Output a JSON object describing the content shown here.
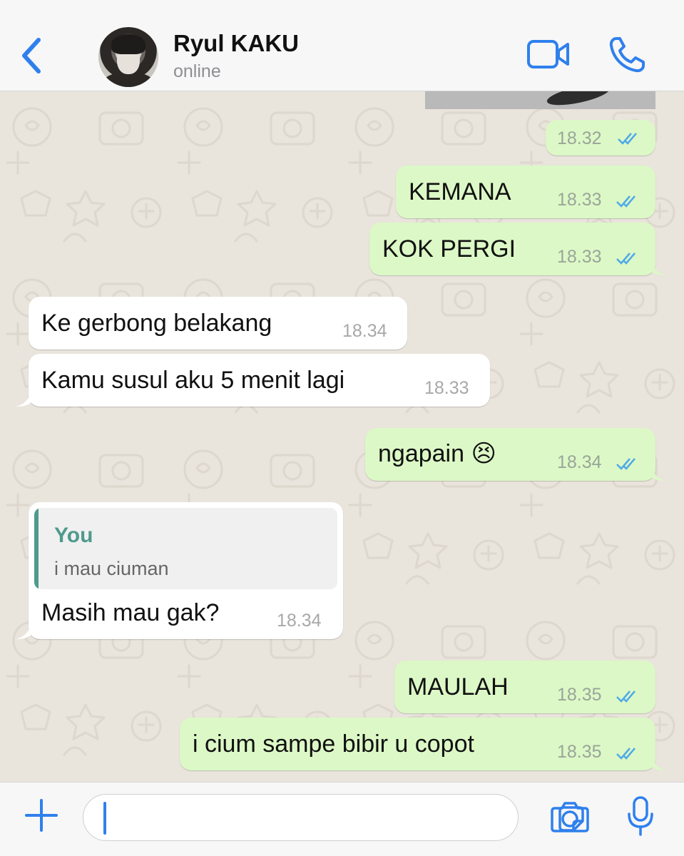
{
  "header": {
    "contact_name": "Ryul KAKU",
    "status": "online",
    "icons": [
      "back-arrow-icon",
      "video-call-icon",
      "phone-call-icon"
    ]
  },
  "colors": {
    "accent": "#2f80ed",
    "outgoing_bubble": "#dcf8c6",
    "incoming_bubble": "#ffffff",
    "read_ticks": "#4fa9e9",
    "quote_accent": "#4f9a8c",
    "chat_background": "#e9e4dc"
  },
  "messages": [
    {
      "direction": "out",
      "text": "",
      "time": "18.32",
      "read": true
    },
    {
      "direction": "out",
      "text": "KEMANA",
      "time": "18.33",
      "read": true
    },
    {
      "direction": "out",
      "text": "KOK PERGI",
      "time": "18.33",
      "read": true
    },
    {
      "direction": "in",
      "text": "Ke gerbong belakang",
      "time": "18.34"
    },
    {
      "direction": "in",
      "text": "Kamu susul aku 5 menit lagi",
      "time": "18.33"
    },
    {
      "direction": "out",
      "text": "ngapain 😣",
      "time": "18.34",
      "read": true
    },
    {
      "direction": "in",
      "text": "Masih mau gak?",
      "time": "18.34",
      "reply_to": {
        "author": "You",
        "text": "i mau ciuman"
      }
    },
    {
      "direction": "out",
      "text": "MAULAH",
      "time": "18.35",
      "read": true
    },
    {
      "direction": "out",
      "text": "i cium sampe bibir u copot",
      "time": "18.35",
      "read": true
    }
  ],
  "input_bar": {
    "placeholder": "",
    "icons": [
      "plus-icon",
      "sticker-icon",
      "camera-icon",
      "microphone-icon"
    ]
  }
}
